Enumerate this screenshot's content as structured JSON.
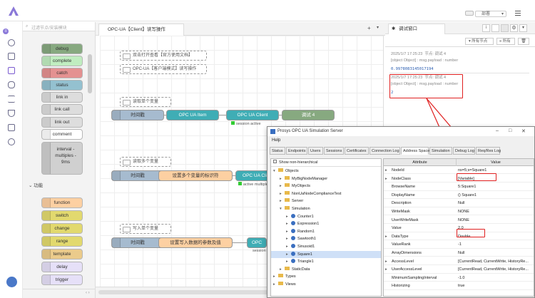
{
  "header": {
    "deploy_label": "部署"
  },
  "palette": {
    "search_placeholder": "过滤节点/安装模块",
    "common_nodes": [
      {
        "label": "debug",
        "color": "#87a980"
      },
      {
        "label": "complete",
        "color": "#c0edc0"
      },
      {
        "label": "catch",
        "color": "#e49191"
      },
      {
        "label": "status",
        "color": "#94c1d0"
      },
      {
        "label": "link in",
        "color": "#dddddd"
      },
      {
        "label": "link call",
        "color": "#dddddd"
      },
      {
        "label": "link out",
        "color": "#dddddd"
      },
      {
        "label": "comment",
        "color": "#ffffff"
      },
      {
        "label": "interval - multiples - 9ms",
        "color": "#d0d0d0"
      }
    ],
    "function_category": "功能",
    "function_nodes": [
      {
        "label": "function",
        "color": "#fdd0a2"
      },
      {
        "label": "switch",
        "color": "#e2d96e"
      },
      {
        "label": "change",
        "color": "#e2d96e"
      },
      {
        "label": "range",
        "color": "#e2d96e"
      },
      {
        "label": "template",
        "color": "#ebcb8b"
      },
      {
        "label": "delay",
        "color": "#e6e0f8"
      },
      {
        "label": "trigger",
        "color": "#e6e0f8"
      }
    ]
  },
  "workspace": {
    "tab_title": "OPC-UA【Client】读写操作",
    "add_tab": "+",
    "comments": [
      "双击打开查看【官方使用文档】",
      "OPC-UA【客户端模式】读写操作",
      "读取单个变量",
      "读取多个变量",
      "写入单个变量"
    ],
    "nodes": {
      "inject": "时间戳",
      "opc_item": "OPC UA Item",
      "opc_client": "OPC UA Client",
      "debug4": "调试 4",
      "func_multi": "设置多个变量的标识符",
      "opc_client_short": "OPC UA Cli",
      "func_write": "设置写入数据的参数及值",
      "opc_short": "OPC"
    },
    "status": {
      "session_active": "session active",
      "active_multiple": "active multiple",
      "session_short": "session"
    }
  },
  "sidebar": {
    "title": "调试窗口",
    "filter_nodes": "所有节点",
    "filter_all": "所有",
    "messages": [
      {
        "time": "2025/1/7 17:25:23",
        "node": "节点: 调试 4",
        "topic": "[object Object] : msg.payload : number",
        "value": "0.9978083145017194"
      },
      {
        "time": "2025/1/7 17:25:23",
        "node": "节点: 调试 4",
        "topic": "[object Object] : msg.payload : number",
        "value": "2"
      }
    ]
  },
  "window": {
    "title": "Prosys OPC UA Simulation Server",
    "menu": "Help",
    "tabs": [
      "Status",
      "Endpoints",
      "Users",
      "Sessions",
      "Certificates",
      "Connection Log",
      "Address Space",
      "Simulation",
      "Debug Log",
      "Req/Res Log"
    ],
    "show_non_hierarchical": "Show non-hierarchical",
    "tree": [
      {
        "label": "Objects",
        "indent": 0,
        "type": "folder",
        "toggle": "▾"
      },
      {
        "label": "MyBigNodeManager",
        "indent": 1,
        "type": "folder",
        "toggle": "▸"
      },
      {
        "label": "MyObjects",
        "indent": 1,
        "type": "folder",
        "toggle": "▸"
      },
      {
        "label": "NonUaNodeComplianceTest",
        "indent": 1,
        "type": "folder",
        "toggle": "▸"
      },
      {
        "label": "Server",
        "indent": 1,
        "type": "folder",
        "toggle": "▸"
      },
      {
        "label": "Simulation",
        "indent": 1,
        "type": "folder",
        "toggle": "▾"
      },
      {
        "label": "Counter1",
        "indent": 2,
        "type": "var",
        "toggle": "▸"
      },
      {
        "label": "Expression1",
        "indent": 2,
        "type": "var",
        "toggle": "▸"
      },
      {
        "label": "Random1",
        "indent": 2,
        "type": "var",
        "toggle": "▸"
      },
      {
        "label": "Sawtooth1",
        "indent": 2,
        "type": "var",
        "toggle": "▸"
      },
      {
        "label": "Sinusoid1",
        "indent": 2,
        "type": "var",
        "toggle": "▸"
      },
      {
        "label": "Square1",
        "indent": 2,
        "type": "var",
        "toggle": "▸",
        "selected": true
      },
      {
        "label": "Triangle1",
        "indent": 2,
        "type": "var",
        "toggle": "▸"
      },
      {
        "label": "StaticData",
        "indent": 1,
        "type": "folder",
        "toggle": "▸"
      },
      {
        "label": "Types",
        "indent": 0,
        "type": "folder",
        "toggle": "▸"
      },
      {
        "label": "Views",
        "indent": 0,
        "type": "folder",
        "toggle": "▸"
      }
    ],
    "attr_header": "Attribute",
    "value_header": "Value",
    "attributes": [
      {
        "name": "NodeId",
        "value": "ns=5;s=Square1",
        "toggle": "▸"
      },
      {
        "name": "NodeClass",
        "value": "[Variable]",
        "toggle": "▸"
      },
      {
        "name": "BrowseName",
        "value": "5:Square1",
        "toggle": ""
      },
      {
        "name": "DisplayName",
        "value": "() Square1",
        "toggle": ""
      },
      {
        "name": "Description",
        "value": "Null",
        "toggle": ""
      },
      {
        "name": "WriteMask",
        "value": "NONE",
        "toggle": ""
      },
      {
        "name": "UserWriteMask",
        "value": "NONE",
        "toggle": ""
      },
      {
        "name": "Value",
        "value": "2.0",
        "toggle": ""
      },
      {
        "name": "DataType",
        "value": "Double",
        "toggle": "▸"
      },
      {
        "name": "ValueRank",
        "value": "-1",
        "toggle": ""
      },
      {
        "name": "ArrayDimensions",
        "value": "Null",
        "toggle": ""
      },
      {
        "name": "AccessLevel",
        "value": "[CurrentRead, CurrentWrite, HistoryRe...",
        "toggle": "▸"
      },
      {
        "name": "UserAccessLevel",
        "value": "[CurrentRead, CurrentWrite, HistoryRe...",
        "toggle": "▸"
      },
      {
        "name": "MinimumSamplingInterval",
        "value": "-1.0",
        "toggle": ""
      },
      {
        "name": "Historizing",
        "value": "true",
        "toggle": ""
      }
    ]
  }
}
